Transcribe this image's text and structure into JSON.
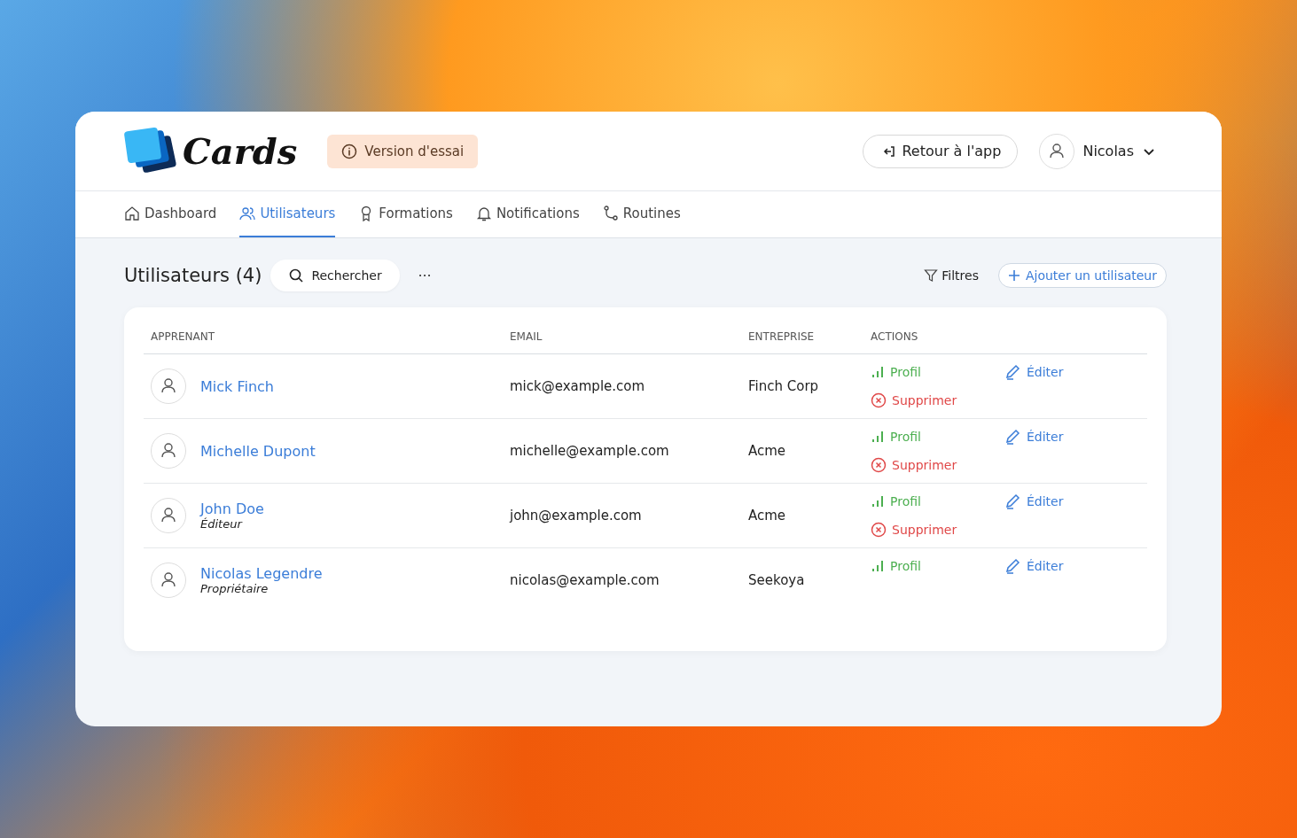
{
  "header": {
    "logo": "Cards",
    "trial_badge": "Version d'essai",
    "back_button": "Retour à l'app",
    "user_menu": "Nicolas"
  },
  "nav": [
    {
      "label": "Dashboard",
      "kind": "home",
      "selected": false
    },
    {
      "label": "Utilisateurs",
      "kind": "users",
      "selected": true
    },
    {
      "label": "Formations",
      "kind": "award",
      "selected": false
    },
    {
      "label": "Notifications",
      "kind": "bell",
      "selected": false
    },
    {
      "label": "Routines",
      "kind": "route",
      "selected": false
    }
  ],
  "toolbar": {
    "title": "Utilisateurs",
    "count": "(4)",
    "search_placeholder": "Rechercher",
    "more": "···",
    "filters": "Filtres",
    "add_button": "Ajouter un utilisateur"
  },
  "table": {
    "columns": [
      "APPRENANT",
      "EMAIL",
      "ENTREPRISE",
      "ACTIONS"
    ],
    "rows": [
      {
        "name": "Mick Finch",
        "email": "mick@example.com",
        "company": "Finch Corp",
        "actions": [
          {
            "kind": "profile",
            "label": "Profil"
          },
          {
            "kind": "edit",
            "label": "Éditer"
          },
          {
            "kind": "delete",
            "label": "Supprimer"
          }
        ]
      },
      {
        "name": "Michelle Dupont",
        "email": "michelle@example.com",
        "company": "Acme",
        "actions": [
          {
            "kind": "profile",
            "label": "Profil"
          },
          {
            "kind": "edit",
            "label": "Éditer"
          },
          {
            "kind": "delete",
            "label": "Supprimer"
          }
        ]
      },
      {
        "name": "John Doe",
        "role": "Éditeur",
        "email": "john@example.com",
        "company": "Acme",
        "actions": [
          {
            "kind": "profile",
            "label": "Profil"
          },
          {
            "kind": "edit",
            "label": "Éditer"
          },
          {
            "kind": "delete",
            "label": "Supprimer"
          }
        ]
      },
      {
        "name": "Nicolas Legendre",
        "role": "Propriétaire",
        "email": "nicolas@example.com",
        "company": "Seekoya",
        "actions": [
          {
            "kind": "profile",
            "label": "Profil"
          },
          {
            "kind": "edit",
            "label": "Éditer"
          }
        ]
      }
    ]
  }
}
